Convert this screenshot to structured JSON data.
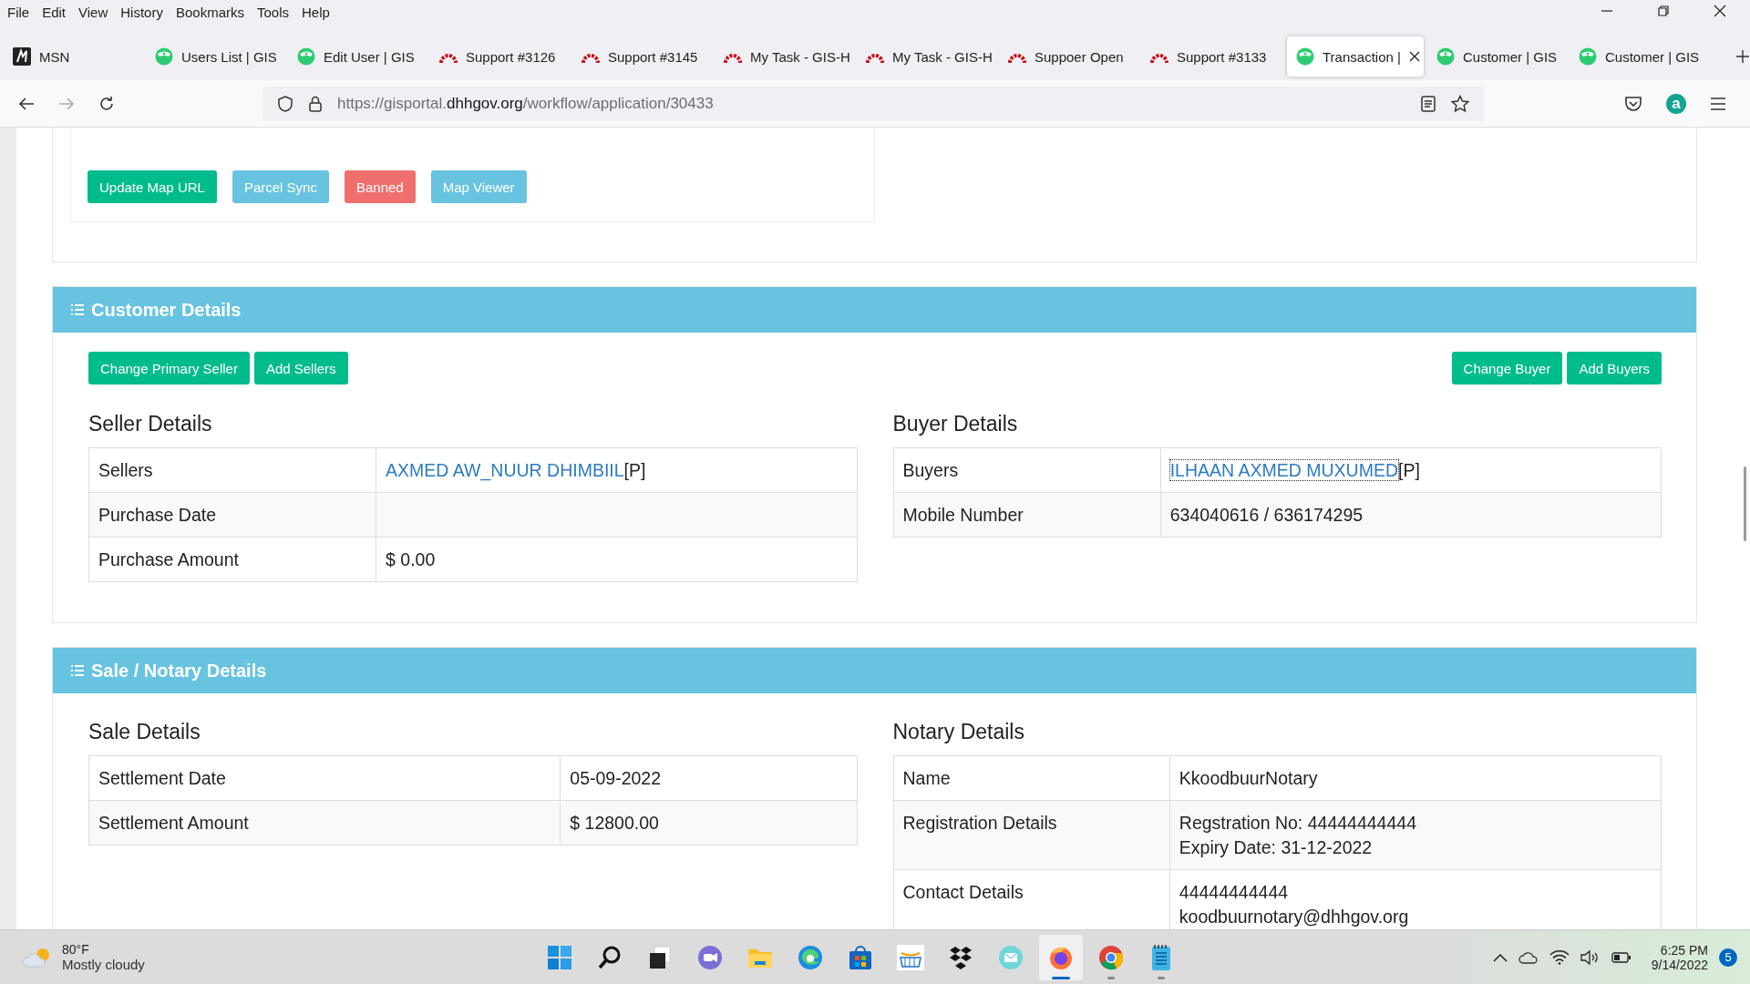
{
  "menu": [
    "File",
    "Edit",
    "View",
    "History",
    "Bookmarks",
    "Tools",
    "Help"
  ],
  "tabs": [
    {
      "kind": "msn",
      "label": "MSN",
      "selected": false
    },
    {
      "kind": "gis",
      "label": "Users List | GIS",
      "selected": false
    },
    {
      "kind": "gis",
      "label": "Edit User | GIS",
      "selected": false
    },
    {
      "kind": "redmine",
      "label": "Support #3126",
      "selected": false
    },
    {
      "kind": "redmine",
      "label": "Support #3145",
      "selected": false
    },
    {
      "kind": "redmine",
      "label": "My Task - GIS-H",
      "selected": false
    },
    {
      "kind": "redmine",
      "label": "My Task - GIS-H",
      "selected": false
    },
    {
      "kind": "redmine",
      "label": "Suppoer Open",
      "selected": false
    },
    {
      "kind": "redmine",
      "label": "Support #3133",
      "selected": false
    },
    {
      "kind": "gis",
      "label": "Transaction |",
      "selected": true
    },
    {
      "kind": "gis",
      "label": "Customer | GIS",
      "selected": false
    },
    {
      "kind": "gis",
      "label": "Customer | GIS",
      "selected": false
    }
  ],
  "address_bar": {
    "url_prefix": "https://gisportal.",
    "url_domain": "dhhgov.org",
    "url_path": "/workflow/application/30433"
  },
  "account_initial": "a",
  "property": {
    "buttons": [
      {
        "label": "Update Map URL",
        "color": "#00bb8b"
      },
      {
        "label": "Parcel Sync",
        "color": "#67c3e0"
      },
      {
        "label": "Banned",
        "color": "#ef6f6c"
      },
      {
        "label": "Map Viewer",
        "color": "#67c3e0"
      }
    ]
  },
  "sections": [
    {
      "title": "Customer Details",
      "left_buttons": [
        "Change Primary Seller",
        "Add Sellers"
      ],
      "right_buttons": [
        "Change Buyer",
        "Add Buyers"
      ],
      "tables": [
        {
          "title": "Seller Details",
          "rows": [
            {
              "label": "Sellers",
              "link": "AXMED AW_NUUR DHIMBIIL",
              "suffix": "[P]",
              "focused": false
            },
            {
              "label": "Purchase Date"
            },
            {
              "label": "Purchase Amount",
              "lines": [
                "$ 0.00"
              ]
            }
          ]
        },
        {
          "title": "Buyer Details",
          "rows": [
            {
              "label": "Buyers",
              "link": "ILHAAN AXMED MUXUMED",
              "suffix": "[P]",
              "focused": true
            },
            {
              "label": "Mobile Number",
              "lines": [
                "634040616 / 636174295"
              ]
            }
          ]
        }
      ]
    },
    {
      "title": "Sale / Notary Details",
      "tables": [
        {
          "title": "Sale Details",
          "rows": [
            {
              "label": "Settlement Date",
              "lines": [
                "05-09-2022"
              ]
            },
            {
              "label": "Settlement Amount",
              "lines": [
                "$ 12800.00"
              ]
            }
          ]
        },
        {
          "title": "Notary Details",
          "rows": [
            {
              "label": "Name",
              "lines": [
                "KkoodbuurNotary"
              ]
            },
            {
              "label": "Registration Details",
              "lines": [
                "Regstration No: 44444444444",
                "Expiry Date: 31-12-2022"
              ]
            },
            {
              "label": "Contact Details",
              "lines": [
                "44444444444",
                "koodbuurnotary@dhhgov.org"
              ]
            }
          ]
        }
      ]
    }
  ],
  "taskbar": {
    "weather": {
      "temp": "80°F",
      "condition": "Mostly cloudy"
    },
    "apps": [
      {
        "kind": "start",
        "running": false,
        "selected": false
      },
      {
        "kind": "search",
        "running": false,
        "selected": false
      },
      {
        "kind": "taskview",
        "running": false,
        "selected": false
      },
      {
        "kind": "chat",
        "running": false,
        "selected": false
      },
      {
        "kind": "folder",
        "running": false,
        "selected": false
      },
      {
        "kind": "edge",
        "running": false,
        "selected": false
      },
      {
        "kind": "store",
        "running": false,
        "selected": false
      },
      {
        "kind": "cart",
        "running": false,
        "selected": false
      },
      {
        "kind": "boxes",
        "running": false,
        "selected": false
      },
      {
        "kind": "mail",
        "running": false,
        "selected": false
      },
      {
        "kind": "firefox",
        "running": true,
        "selected": true
      },
      {
        "kind": "chrome",
        "running": true,
        "selected": false
      },
      {
        "kind": "notepad",
        "running": true,
        "selected": false
      }
    ],
    "clock": {
      "time": "6:25 PM",
      "date": "9/14/2022"
    },
    "notification_count": "5"
  }
}
